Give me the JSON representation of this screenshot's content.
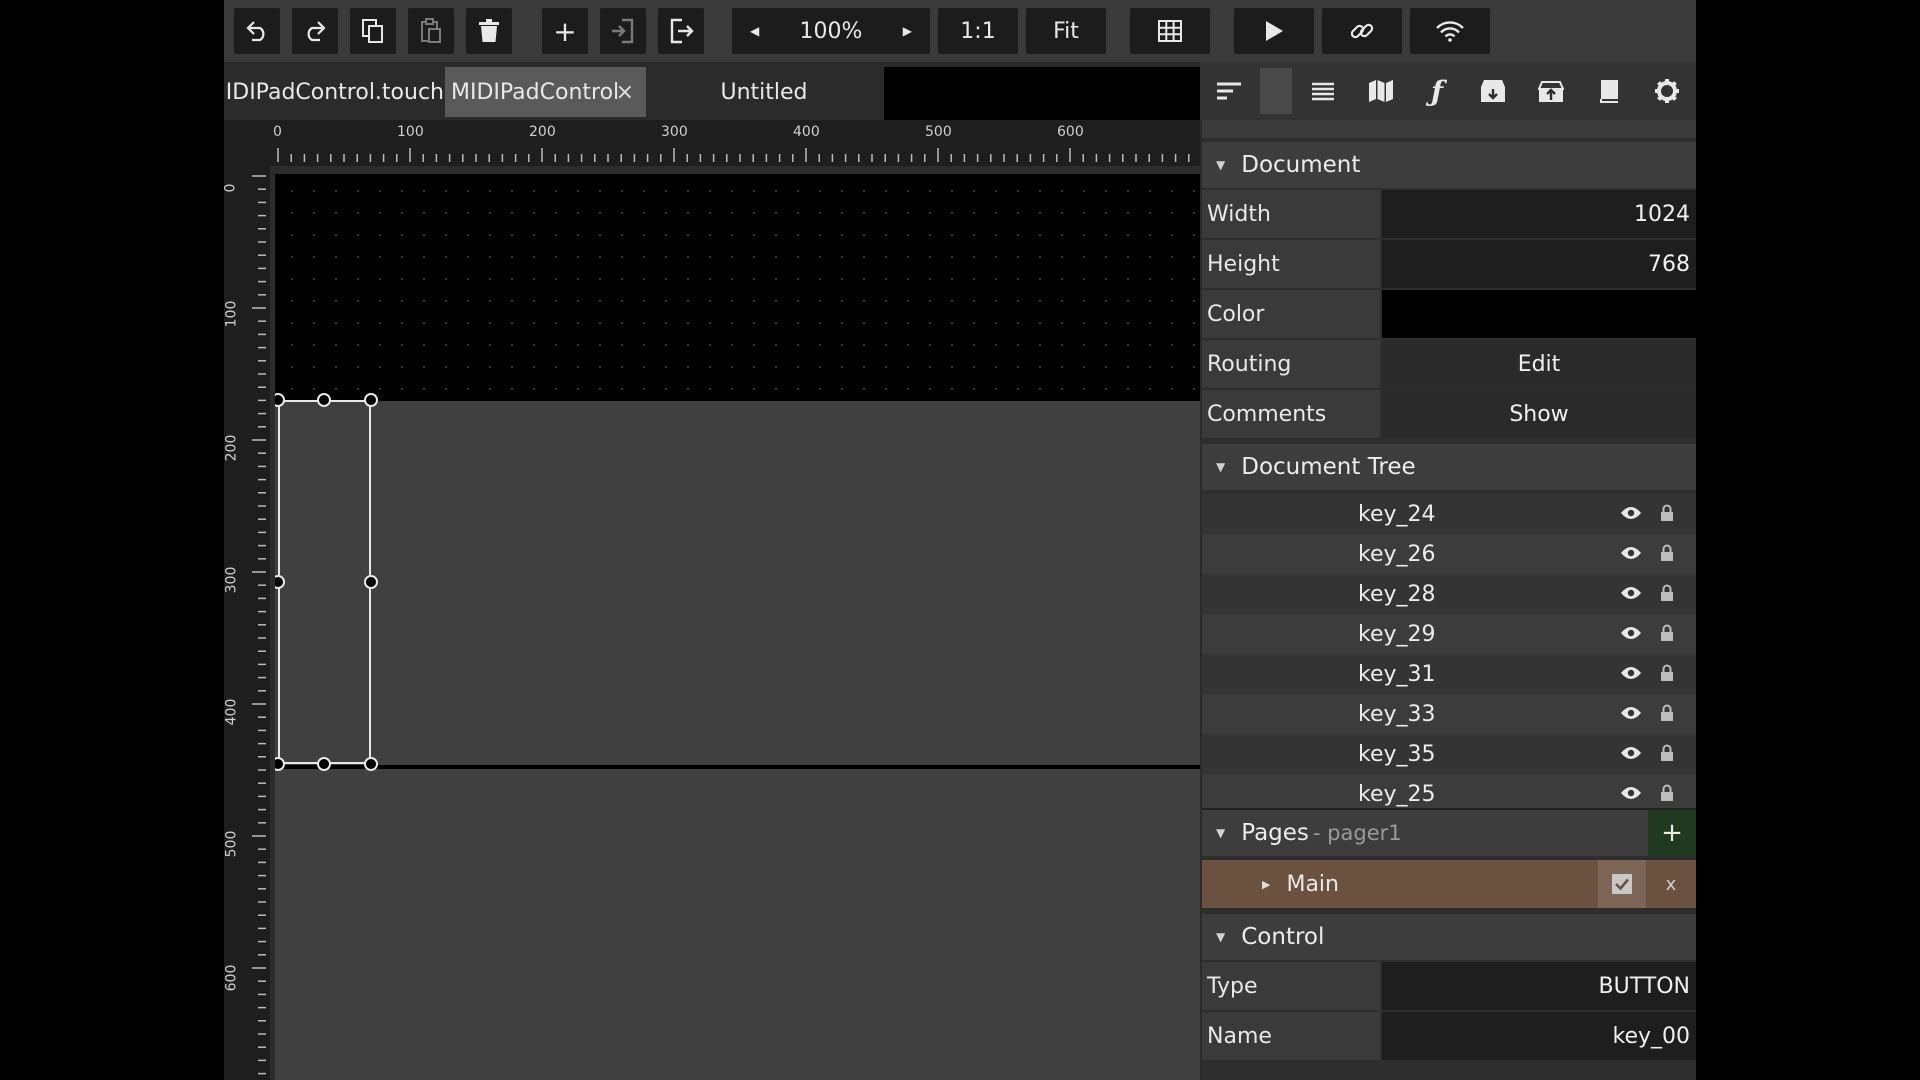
{
  "toolbar": {
    "zoom": "100%",
    "one_to_one": "1:1",
    "fit": "Fit",
    "plus": "+"
  },
  "tabs": [
    {
      "label": "MIDIPadControl.touch"
    },
    {
      "label": "MIDIPadControl",
      "close": "×"
    },
    {
      "label": "Untitled"
    }
  ],
  "ruler": {
    "top": [
      "0",
      "100",
      "200",
      "300",
      "400",
      "500",
      "600"
    ],
    "left": [
      "0",
      "100",
      "200",
      "300",
      "400",
      "500",
      "600"
    ]
  },
  "document": {
    "header": "Document",
    "width_label": "Width",
    "width_value": "1024",
    "height_label": "Height",
    "height_value": "768",
    "color_label": "Color",
    "routing_label": "Routing",
    "routing_value": "Edit",
    "comments_label": "Comments",
    "comments_value": "Show"
  },
  "tree": {
    "header": "Document Tree",
    "items": [
      "key_24",
      "key_26",
      "key_28",
      "key_29",
      "key_31",
      "key_33",
      "key_35",
      "key_25"
    ]
  },
  "pages": {
    "header": "Pages",
    "sub": "- pager1",
    "add": "+",
    "item": "Main",
    "remove": "x"
  },
  "control": {
    "header": "Control",
    "type_label": "Type",
    "type_value": "BUTTON",
    "name_label": "Name",
    "name_value": "key_00"
  },
  "colors": {
    "page_row": "#6b5240",
    "add_button": "#1f3a1f"
  }
}
